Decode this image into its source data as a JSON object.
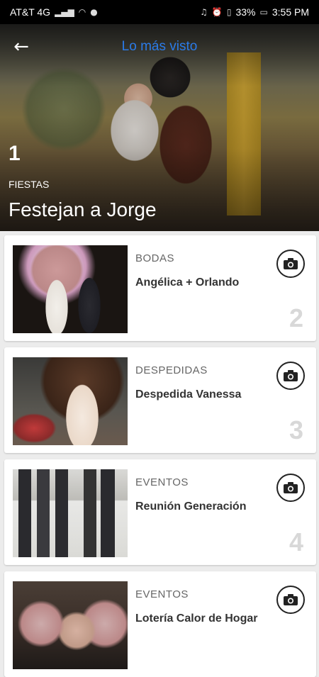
{
  "status": {
    "carrier": "AT&T 4G",
    "left_icons": [
      "signal-icon",
      "wifi-icon",
      "spotify-icon"
    ],
    "right_icons": [
      "headphones-icon",
      "alarm-icon",
      "vibrate-icon"
    ],
    "battery": "33%",
    "time": "3:55 PM"
  },
  "header": {
    "title": "Lo más visto",
    "title_color": "#2b7be8"
  },
  "featured": {
    "rank": "1",
    "category": "FIESTAS",
    "title": "Festejan a Jorge"
  },
  "items": [
    {
      "category": "BODAS",
      "title": "Angélica + Orlando",
      "rank": "2"
    },
    {
      "category": "DESPEDIDAS",
      "title": "Despedida Vanessa",
      "rank": "3"
    },
    {
      "category": "EVENTOS",
      "title": "Reunión Generación",
      "rank": "4"
    },
    {
      "category": "EVENTOS",
      "title": "Lotería Calor de Hogar",
      "rank": ""
    }
  ]
}
